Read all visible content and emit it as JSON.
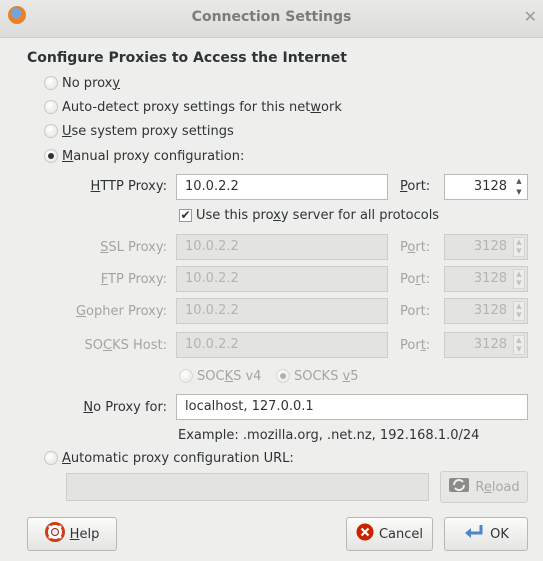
{
  "window": {
    "title": "Connection Settings"
  },
  "heading": "Configure Proxies to Access the Internet",
  "proxy_modes": [
    {
      "pre": "",
      "acc": "",
      "post": "No prox",
      "acc2": "y",
      "post2": "",
      "selected": false
    },
    {
      "pre": "Auto-detect proxy settings for this net",
      "acc": "w",
      "post": "ork",
      "selected": false
    },
    {
      "pre": "",
      "acc": "U",
      "post": "se system proxy settings",
      "selected": false
    },
    {
      "pre": "",
      "acc": "M",
      "post": "anual proxy configuration:",
      "selected": true
    }
  ],
  "http": {
    "label_acc": "H",
    "label_rest": "TTP Proxy:",
    "value": "10.0.2.2",
    "port_acc": "P",
    "port_rest": "ort:",
    "port": "3128"
  },
  "share_checkbox": {
    "pre": "Use this pro",
    "acc": "x",
    "post": "y server for all protocols",
    "checked": true,
    "check_glyph": "✔"
  },
  "ssl": {
    "label_acc": "S",
    "label_rest": "SL Proxy:",
    "value": "10.0.2.2",
    "port_pre": "P",
    "port_acc": "o",
    "port_rest": "rt:",
    "port": "3128"
  },
  "ftp": {
    "label_acc": "F",
    "label_rest": "TP Proxy:",
    "value": "10.0.2.2",
    "port_pre": "Po",
    "port_acc": "r",
    "port_rest": "t:",
    "port": "3128"
  },
  "gopher": {
    "label_acc": "G",
    "label_rest": "opher Proxy:",
    "value": "10.0.2.2",
    "port_label": "Port:",
    "port": "3128"
  },
  "socks": {
    "label_pre": "SO",
    "label_acc": "C",
    "label_rest": "KS Host:",
    "value": "10.0.2.2",
    "port_pre": "Por",
    "port_acc": "t",
    "port_rest": ":",
    "port": "3128"
  },
  "socks_versions": [
    {
      "pre": "SOC",
      "acc": "K",
      "post": "S v4",
      "selected": false
    },
    {
      "pre": "SOCKS ",
      "acc": "v",
      "post": "5",
      "selected": true
    }
  ],
  "no_proxy": {
    "label_acc": "N",
    "label_rest": "o Proxy for:",
    "value": "localhost, 127.0.0.1"
  },
  "example": "Example: .mozilla.org, .net.nz, 192.168.1.0/24",
  "auto_config": {
    "pre": "",
    "acc": "A",
    "post": "utomatic proxy configuration URL:",
    "value": "",
    "selected": false
  },
  "buttons": {
    "reload": {
      "pre": "R",
      "acc": "e",
      "post": "load"
    },
    "help": {
      "acc": "H",
      "rest": "elp"
    },
    "cancel": "Cancel",
    "ok": "OK"
  },
  "icons": {
    "app": "firefox-icon",
    "close": "close-icon",
    "spin_up": "▲",
    "spin_down": "▼",
    "close_glyph": "✕"
  },
  "colors": {
    "cancel_red": "#cc2200",
    "help_ring": "#d13c1b",
    "ok_blue": "#4a86c8"
  }
}
